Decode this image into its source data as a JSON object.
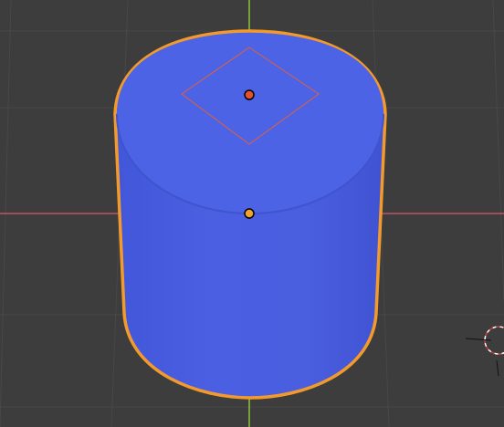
{
  "viewport": {
    "background_color": "#3d3d3d",
    "grid_color": "#4a4a4a",
    "x_axis_color": "#c0546a",
    "y_axis_color": "#8fc43a"
  },
  "object": {
    "type": "cylinder",
    "fill_color": "#4a5fe0",
    "cap_color": "#4d63e6",
    "selected": true,
    "outline_color": "#f39a2c"
  },
  "origin_point": {
    "icon": "origin-dot-icon",
    "color": "#f3a12f"
  },
  "light_gizmo": {
    "icon": "area-light-diamond-icon",
    "line_color": "#e0603a",
    "dot_color": "#e6512b"
  },
  "camera_gizmo": {
    "icon": "3d-cursor-icon",
    "colors": [
      "#ffffff",
      "#d43a3a"
    ]
  }
}
